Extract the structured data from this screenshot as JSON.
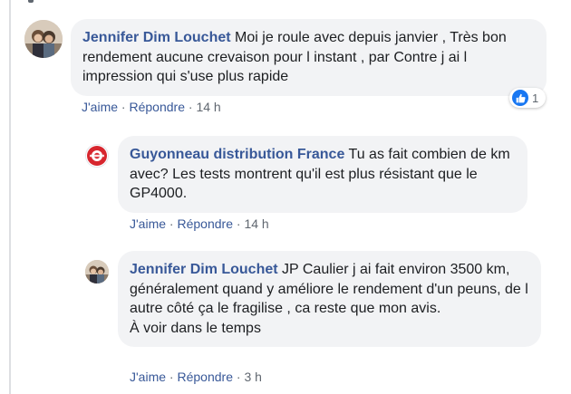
{
  "comments": [
    {
      "author": "Jennifer Dim Louchet",
      "text": "Moi je roule avec depuis janvier , Très bon rendement aucune crevaison pour l instant , par Contre j ai l impression qui s'use plus rapide",
      "like_label": "J'aime",
      "reply_label": "Répondre",
      "separator": "·",
      "time": "14 h",
      "reaction_count": "1",
      "reaction_icon": "thumbs-up-icon"
    },
    {
      "author": "Guyonneau distribution France",
      "text": "Tu as fait combien de km avec? Les tests montrent qu'il est plus résistant que le GP4000.",
      "like_label": "J'aime",
      "reply_label": "Répondre",
      "separator": "·",
      "time": "14 h"
    },
    {
      "author": "Jennifer Dim Louchet",
      "text_lines": [
        "JP Caulier j ai fait environ 3500 km, généralement quand y améliore le rendement d'un peuns, de l autre côté ça le fragilise , ca reste que mon avis.",
        "À voir dans le temps"
      ],
      "like_label": "J'aime",
      "reply_label": "Répondre",
      "separator": "·",
      "time": "3 h"
    }
  ],
  "colors": {
    "author_link": "#385898",
    "bubble_bg": "#f2f3f5",
    "text": "#1c1e21",
    "muted": "#606770",
    "like_blue": "#1877f2"
  }
}
